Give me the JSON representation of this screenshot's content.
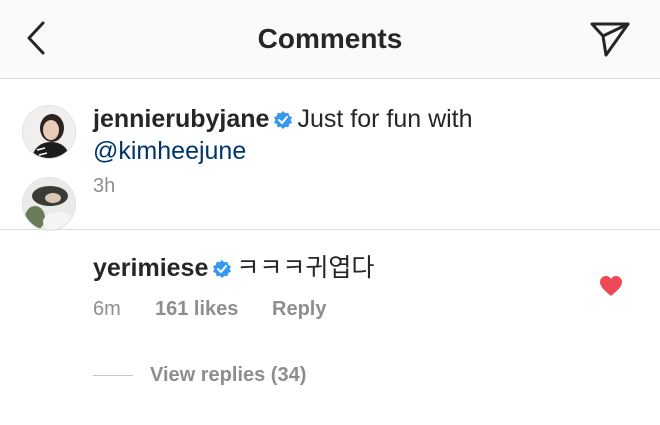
{
  "header": {
    "title": "Comments",
    "back_icon": "chevron-left-icon",
    "share_icon": "paper-plane-icon"
  },
  "post": {
    "username": "jennierubyjane",
    "verified": true,
    "caption": "Just for fun with",
    "mention": "@kimheejune",
    "time": "3h"
  },
  "comment": {
    "username": "yerimiese",
    "verified": true,
    "text": "ㅋㅋㅋ귀엽다",
    "time": "6m",
    "likes": "161 likes",
    "reply_label": "Reply",
    "liked": true
  },
  "view_replies": {
    "label": "View replies (34)"
  },
  "colors": {
    "verified_blue": "#3897f0",
    "heart_red": "#ed4956",
    "mention_blue": "#003569",
    "meta_gray": "#8e8e8e"
  }
}
